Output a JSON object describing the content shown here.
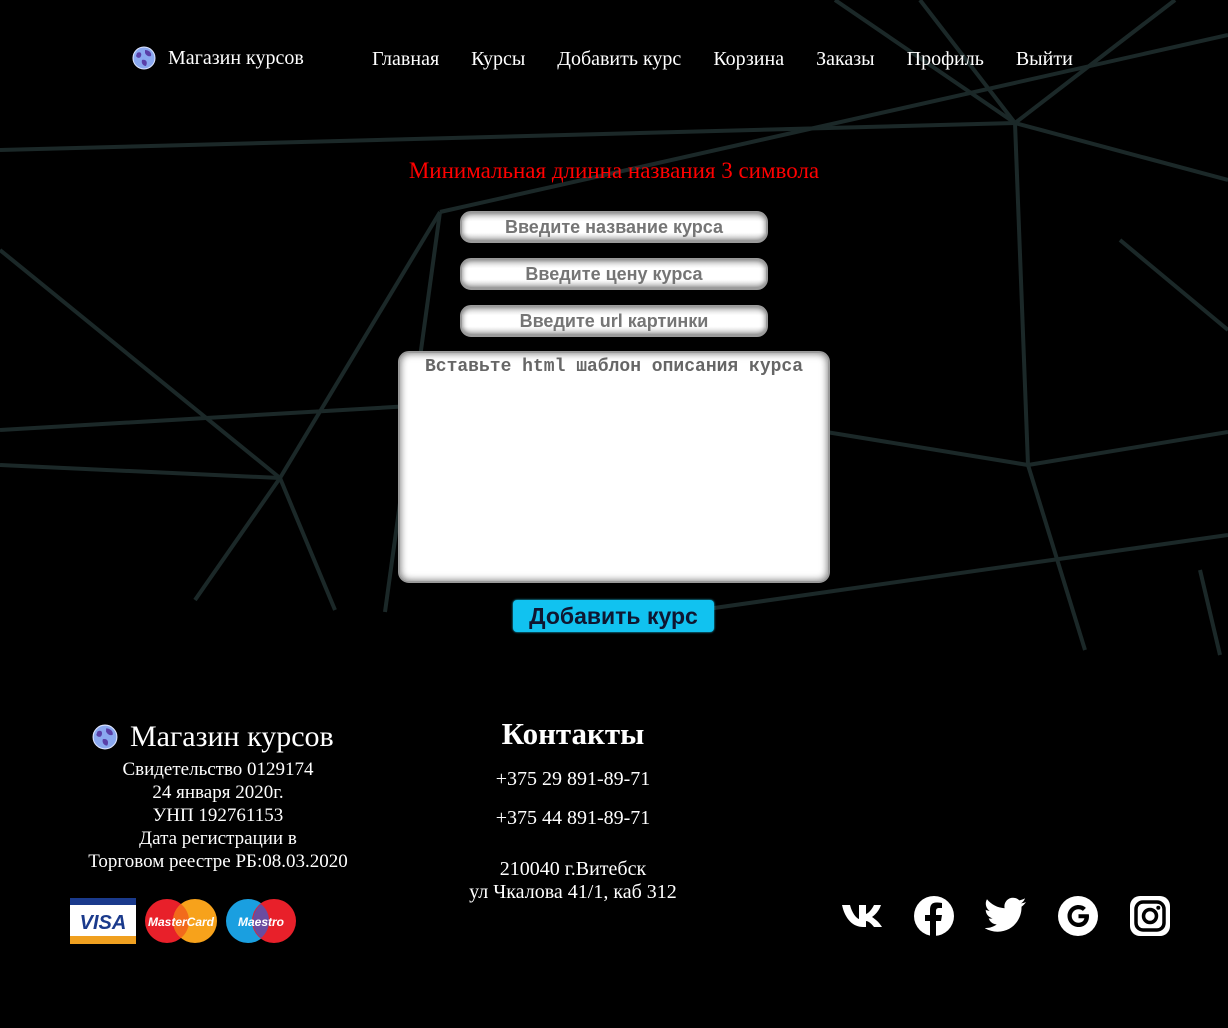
{
  "header": {
    "brand": "Магазин курсов",
    "nav": [
      "Главная",
      "Курсы",
      "Добавить курс",
      "Корзина",
      "Заказы",
      "Профиль",
      "Выйти"
    ]
  },
  "form": {
    "error": "Минимальная длинна названия 3 символа",
    "name_placeholder": "Введите название курса",
    "price_placeholder": "Введите цену курса",
    "image_placeholder": "Введите url картинки",
    "description_placeholder": "Вставьте html шаблон описания курса",
    "submit_label": "Добавить курс"
  },
  "footer": {
    "brand": "Магазин курсов",
    "legal": [
      "Свидетельство 0129174",
      "24 января 2020г.",
      "УНП 192761153",
      "Дата регистрации в",
      "Торговом реестре РБ:08.03.2020"
    ],
    "payment_cards": {
      "visa": "VISA",
      "mastercard": "MasterCard",
      "maestro": "Maestro"
    },
    "contacts_title": "Контакты",
    "phones": [
      "+375 29 891-89-71",
      "+375 44 891-89-71"
    ],
    "address": [
      "210040 г.Витебск",
      "ул Чкалова 41/1, каб 312"
    ],
    "social_icons": [
      "vk-icon",
      "facebook-icon",
      "twitter-icon",
      "google-icon",
      "instagram-icon"
    ]
  },
  "colors": {
    "background": "#000000",
    "error": "#ff0000",
    "accent": "#11c2f0",
    "lines": "#1b2a2a"
  }
}
